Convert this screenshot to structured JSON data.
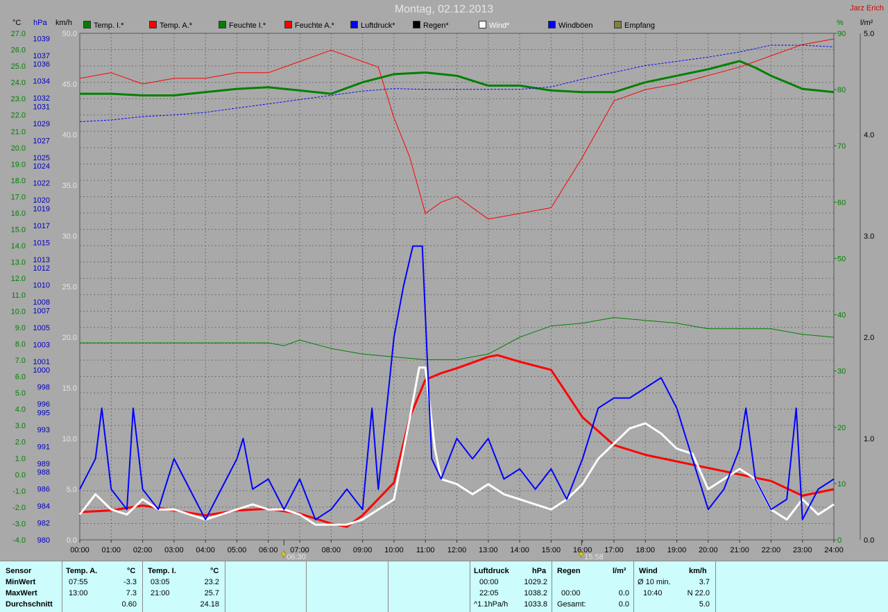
{
  "title": "Montag, 02.12.2013",
  "author": "Jarz Erich",
  "legend": [
    {
      "label": "Temp. I.*",
      "color": "#008000"
    },
    {
      "label": "Temp. A.*",
      "color": "#ff0000"
    },
    {
      "label": "Feuchte I.*",
      "color": "#008000"
    },
    {
      "label": "Feuchte A.*",
      "color": "#ff0000"
    },
    {
      "label": "Luftdruck*",
      "color": "#0000ff"
    },
    {
      "label": "Regen*",
      "color": "#000000"
    },
    {
      "label": "Wind*",
      "color": "#ffffff"
    },
    {
      "label": "Windböen",
      "color": "#0000ff"
    },
    {
      "label": "Empfang",
      "color": "#808040"
    }
  ],
  "axis_units": {
    "temp": "°C",
    "pressure": "hPa",
    "wind": "km/h",
    "humidity": "%",
    "rain": "l/m²"
  },
  "chart_data": {
    "type": "line",
    "title": "Montag, 02.12.2013",
    "x": [
      "00:00",
      "01:00",
      "02:00",
      "03:00",
      "04:00",
      "05:00",
      "06:00",
      "07:00",
      "08:00",
      "09:00",
      "10:00",
      "11:00",
      "12:00",
      "13:00",
      "14:00",
      "15:00",
      "16:00",
      "17:00",
      "18:00",
      "19:00",
      "20:00",
      "21:00",
      "22:00",
      "23:00",
      "24:00"
    ],
    "marker_labels": [
      "06:30",
      "15:58"
    ],
    "axes": {
      "temp": {
        "ticks": [
          "-4.0",
          "-3.0",
          "-2.0",
          "-1.0",
          "0.0",
          "1.0",
          "2.0",
          "3.0",
          "4.0",
          "5.0",
          "6.0",
          "7.0",
          "8.0",
          "9.0",
          "10.0",
          "11.0",
          "12.0",
          "13.0",
          "14.0",
          "15.0",
          "16.0",
          "17.0",
          "18.0",
          "19.0",
          "20.0",
          "21.0",
          "22.0",
          "23.0",
          "24.0",
          "25.0",
          "26.0",
          "27.0"
        ],
        "ylim": [
          -4,
          27
        ]
      },
      "pressure": {
        "ticks": [
          "980",
          "982",
          "984",
          "986",
          "988",
          "989",
          "991",
          "993",
          "995",
          "996",
          "998",
          "1000",
          "1001",
          "1003",
          "1005",
          "1007",
          "1008",
          "1010",
          "1012",
          "1013",
          "1015",
          "1017",
          "1019",
          "1020",
          "1022",
          "1024",
          "1025",
          "1027",
          "1029",
          "1031",
          "1032",
          "1034",
          "1036",
          "1037",
          "1039"
        ]
      },
      "wind": {
        "ticks": [
          "0.0",
          "5.0",
          "10.0",
          "15.0",
          "20.0",
          "25.0",
          "30.0",
          "35.0",
          "40.0",
          "45.0",
          "50.0"
        ],
        "ylim": [
          0,
          50
        ]
      },
      "humidity": {
        "ticks": [
          "0",
          "10",
          "20",
          "30",
          "40",
          "50",
          "60",
          "70",
          "80",
          "90"
        ],
        "ylim": [
          0,
          90
        ]
      },
      "rain": {
        "ticks": [
          "0.0",
          "1.0",
          "2.0",
          "3.0",
          "4.0",
          "5.0"
        ],
        "ylim": [
          0,
          5
        ]
      }
    },
    "series": [
      {
        "name": "Temp. I.*",
        "axis": "temp",
        "color": "#008000",
        "width": 3,
        "points": [
          [
            0,
            23.3
          ],
          [
            1,
            23.3
          ],
          [
            2,
            23.2
          ],
          [
            3,
            23.2
          ],
          [
            4,
            23.4
          ],
          [
            5,
            23.6
          ],
          [
            6,
            23.7
          ],
          [
            7,
            23.5
          ],
          [
            8,
            23.3
          ],
          [
            9,
            24.0
          ],
          [
            10,
            24.5
          ],
          [
            11,
            24.6
          ],
          [
            12,
            24.4
          ],
          [
            13,
            23.8
          ],
          [
            14,
            23.8
          ],
          [
            15,
            23.5
          ],
          [
            16,
            23.4
          ],
          [
            17,
            23.4
          ],
          [
            18,
            24.0
          ],
          [
            19,
            24.4
          ],
          [
            20,
            24.8
          ],
          [
            21,
            25.3
          ],
          [
            21.5,
            24.9
          ],
          [
            22,
            24.4
          ],
          [
            23,
            23.6
          ],
          [
            24,
            23.4
          ]
        ]
      },
      {
        "name": "Temp. A.*",
        "axis": "temp",
        "color": "#ff0000",
        "width": 3,
        "points": [
          [
            0,
            -2.3
          ],
          [
            1,
            -2.2
          ],
          [
            2,
            -1.9
          ],
          [
            3,
            -2.2
          ],
          [
            4,
            -2.5
          ],
          [
            5,
            -2.2
          ],
          [
            6,
            -2.1
          ],
          [
            7,
            -2.4
          ],
          [
            8,
            -3.0
          ],
          [
            8.5,
            -3.2
          ],
          [
            9,
            -2.5
          ],
          [
            10,
            -0.5
          ],
          [
            10.5,
            3.5
          ],
          [
            11,
            5.8
          ],
          [
            11.5,
            6.2
          ],
          [
            12,
            6.5
          ],
          [
            13,
            7.2
          ],
          [
            13.3,
            7.3
          ],
          [
            14,
            6.9
          ],
          [
            15,
            6.4
          ],
          [
            16,
            3.5
          ],
          [
            17,
            1.8
          ],
          [
            18,
            1.2
          ],
          [
            19,
            0.8
          ],
          [
            20,
            0.4
          ],
          [
            21,
            0.0
          ],
          [
            22,
            -0.4
          ],
          [
            23,
            -1.3
          ],
          [
            24,
            -0.9
          ]
        ]
      },
      {
        "name": "Feuchte I.*",
        "axis": "humidity",
        "color": "#008000",
        "width": 1,
        "points": [
          [
            0,
            35
          ],
          [
            6,
            35
          ],
          [
            6.5,
            34.5
          ],
          [
            7,
            35.5
          ],
          [
            8,
            34
          ],
          [
            9,
            33
          ],
          [
            10,
            32.5
          ],
          [
            11,
            32
          ],
          [
            12,
            32
          ],
          [
            13,
            33
          ],
          [
            14,
            36
          ],
          [
            15,
            38
          ],
          [
            16,
            38.5
          ],
          [
            17,
            39.5
          ],
          [
            18,
            39
          ],
          [
            19,
            38.5
          ],
          [
            20,
            37.5
          ],
          [
            21,
            37.5
          ],
          [
            22,
            37.5
          ],
          [
            23,
            36.5
          ],
          [
            24,
            36
          ]
        ]
      },
      {
        "name": "Feuchte A.*",
        "axis": "humidity",
        "color": "#ff0000",
        "width": 1,
        "points": [
          [
            0,
            82
          ],
          [
            1,
            83
          ],
          [
            2,
            81
          ],
          [
            3,
            82
          ],
          [
            4,
            82
          ],
          [
            5,
            83
          ],
          [
            6,
            83
          ],
          [
            7,
            85
          ],
          [
            8,
            87
          ],
          [
            9,
            85
          ],
          [
            9.5,
            84
          ],
          [
            10,
            75
          ],
          [
            10.5,
            68
          ],
          [
            11,
            58
          ],
          [
            11.5,
            60
          ],
          [
            12,
            61
          ],
          [
            13,
            57
          ],
          [
            14,
            58
          ],
          [
            15,
            59
          ],
          [
            16,
            68
          ],
          [
            17,
            78
          ],
          [
            18,
            80
          ],
          [
            19,
            81
          ],
          [
            20,
            82.5
          ],
          [
            21,
            84
          ],
          [
            22,
            86
          ],
          [
            23,
            88
          ],
          [
            24,
            89
          ]
        ]
      },
      {
        "name": "Luftdruck*",
        "axis": "pressure_hpa",
        "color": "#0000ff",
        "width": 1,
        "dashed": true,
        "points": [
          [
            0,
            1029.2
          ],
          [
            1,
            1029.4
          ],
          [
            2,
            1029.8
          ],
          [
            3,
            1030.0
          ],
          [
            4,
            1030.3
          ],
          [
            5,
            1030.8
          ],
          [
            6,
            1031.3
          ],
          [
            7,
            1031.8
          ],
          [
            8,
            1032.3
          ],
          [
            9,
            1032.8
          ],
          [
            10,
            1033.1
          ],
          [
            11,
            1033.0
          ],
          [
            12,
            1033.0
          ],
          [
            13,
            1033.0
          ],
          [
            14,
            1033.0
          ],
          [
            15,
            1033.3
          ],
          [
            16,
            1034.2
          ],
          [
            17,
            1035.0
          ],
          [
            18,
            1035.8
          ],
          [
            19,
            1036.3
          ],
          [
            20,
            1036.8
          ],
          [
            21,
            1037.4
          ],
          [
            22,
            1038.2
          ],
          [
            23,
            1038.2
          ],
          [
            24,
            1038.0
          ]
        ]
      },
      {
        "name": "Wind*",
        "axis": "wind",
        "color": "#ffffff",
        "width": 3,
        "points": [
          [
            0,
            2.5
          ],
          [
            0.5,
            4.5
          ],
          [
            1,
            3
          ],
          [
            1.5,
            2.5
          ],
          [
            2,
            4
          ],
          [
            2.5,
            3
          ],
          [
            3,
            3
          ],
          [
            3.5,
            2.5
          ],
          [
            4,
            2
          ],
          [
            4.5,
            2.5
          ],
          [
            5,
            3
          ],
          [
            5.5,
            3.5
          ],
          [
            6,
            3
          ],
          [
            6.5,
            3
          ],
          [
            7,
            2.5
          ],
          [
            7.5,
            1.5
          ],
          [
            8,
            1.5
          ],
          [
            8.5,
            1.5
          ],
          [
            9,
            2
          ],
          [
            9.5,
            3
          ],
          [
            10,
            4
          ],
          [
            10.5,
            12
          ],
          [
            10.8,
            17
          ],
          [
            11,
            17
          ],
          [
            11.3,
            9
          ],
          [
            11.5,
            6
          ],
          [
            12,
            5.5
          ],
          [
            12.5,
            4.5
          ],
          [
            13,
            5.5
          ],
          [
            13.5,
            4.5
          ],
          [
            14,
            4
          ],
          [
            14.5,
            3.5
          ],
          [
            15,
            3
          ],
          [
            15.5,
            4
          ],
          [
            16,
            5.5
          ],
          [
            16.5,
            8
          ],
          [
            17,
            9.5
          ],
          [
            17.5,
            11
          ],
          [
            18,
            11.5
          ],
          [
            18.5,
            10.5
          ],
          [
            19,
            9
          ],
          [
            19.5,
            8.5
          ],
          [
            20,
            5
          ],
          [
            20.5,
            6
          ],
          [
            21,
            7
          ],
          [
            21.5,
            6
          ],
          [
            22,
            3
          ],
          [
            22.5,
            2
          ],
          [
            23,
            4
          ],
          [
            23.5,
            2.5
          ],
          [
            24,
            3.5
          ]
        ]
      },
      {
        "name": "Windböen",
        "axis": "wind",
        "color": "#0000ff",
        "width": 2,
        "points": [
          [
            0,
            5
          ],
          [
            0.5,
            8
          ],
          [
            0.7,
            13
          ],
          [
            1,
            5
          ],
          [
            1.5,
            3
          ],
          [
            1.7,
            13
          ],
          [
            2,
            5
          ],
          [
            2.5,
            3
          ],
          [
            3,
            8
          ],
          [
            3.5,
            5
          ],
          [
            4,
            2
          ],
          [
            4.5,
            5
          ],
          [
            5,
            8
          ],
          [
            5.2,
            10
          ],
          [
            5.5,
            5
          ],
          [
            6,
            6
          ],
          [
            6.5,
            3
          ],
          [
            7,
            6
          ],
          [
            7.5,
            2
          ],
          [
            8,
            3
          ],
          [
            8.5,
            5
          ],
          [
            9,
            3
          ],
          [
            9.3,
            13
          ],
          [
            9.5,
            5
          ],
          [
            10,
            20
          ],
          [
            10.3,
            25
          ],
          [
            10.6,
            29
          ],
          [
            10.9,
            29
          ],
          [
            11.2,
            8
          ],
          [
            11.5,
            6
          ],
          [
            12,
            10
          ],
          [
            12.5,
            8
          ],
          [
            13,
            10
          ],
          [
            13.5,
            6
          ],
          [
            14,
            7
          ],
          [
            14.5,
            5
          ],
          [
            15,
            7
          ],
          [
            15.5,
            4
          ],
          [
            16,
            8
          ],
          [
            16.5,
            13
          ],
          [
            17,
            14
          ],
          [
            17.5,
            14
          ],
          [
            18,
            15
          ],
          [
            18.5,
            16
          ],
          [
            19,
            13
          ],
          [
            19.5,
            8
          ],
          [
            20,
            3
          ],
          [
            20.5,
            5
          ],
          [
            21,
            9
          ],
          [
            21.2,
            13
          ],
          [
            21.5,
            6
          ],
          [
            22,
            3
          ],
          [
            22.5,
            4
          ],
          [
            22.8,
            13
          ],
          [
            23,
            2
          ],
          [
            23.5,
            5
          ],
          [
            24,
            6
          ]
        ]
      }
    ]
  },
  "table": {
    "sensor": {
      "header": "Sensor",
      "rows": [
        "MinWert",
        "MaxWert",
        "Durchschnitt"
      ]
    },
    "temp_a": {
      "header": "Temp. A.",
      "unit": "°C",
      "times": [
        "07:55",
        "13:00",
        ""
      ],
      "values": [
        "-3.3",
        "7.3",
        "0.60"
      ]
    },
    "temp_i": {
      "header": "Temp. I.",
      "unit": "°C",
      "times": [
        "03:05",
        "21:00",
        ""
      ],
      "values": [
        "23.2",
        "25.7",
        "24.18"
      ]
    },
    "pressure": {
      "header": "Luftdruck",
      "unit": "hPa",
      "times": [
        "00:00",
        "22:05",
        "^1.1hPa/h"
      ],
      "values": [
        "1029.2",
        "1038.2",
        "1033.8"
      ]
    },
    "rain": {
      "header": "Regen",
      "unit": "l/m²",
      "times": [
        "",
        "00:00",
        "Gesamt:"
      ],
      "values": [
        "",
        "0.0",
        "0.0"
      ]
    },
    "wind": {
      "header": "Wind",
      "unit": "km/h",
      "times": [
        "Ø 10 min.",
        "10:40",
        ""
      ],
      "values": [
        "3.7",
        "N 22.0",
        "5.0"
      ]
    }
  }
}
